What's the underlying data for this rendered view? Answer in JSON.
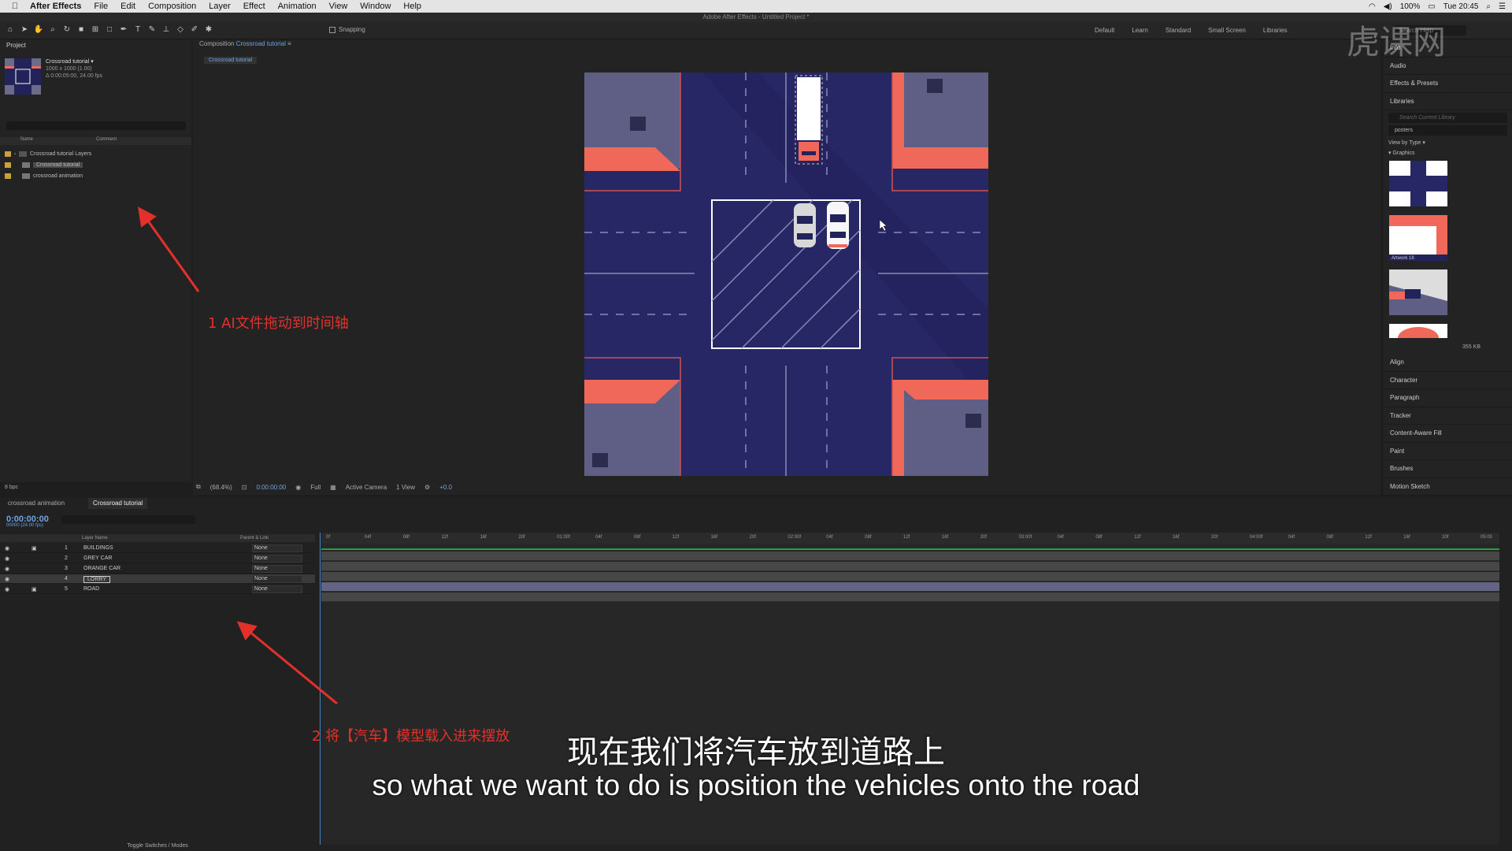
{
  "menubar": {
    "app_name": "After Effects",
    "items": [
      "File",
      "Edit",
      "Composition",
      "Layer",
      "Effect",
      "Animation",
      "View",
      "Window",
      "Help"
    ],
    "battery": "100%",
    "clock": "Tue 20:45"
  },
  "window_title": "Adobe After Effects - Untitled Project *",
  "toolbar": {
    "snapping_label": "Snapping",
    "workspaces": [
      "Default",
      "Learn",
      "Standard",
      "Small Screen",
      "Libraries"
    ],
    "search_placeholder": "Search Help"
  },
  "project_panel": {
    "tab": "Project",
    "comp_name": "Crossroad tutorial ▾",
    "comp_size": "1000 x 1000 (1.00)",
    "comp_duration": "Δ 0:00:05:00, 24.00 fps",
    "col_name": "Name",
    "col_comment": "Comment",
    "items": [
      {
        "label": "Crossroad tutorial Layers"
      },
      {
        "label": "Crossroad tutorial"
      },
      {
        "label": "crossroad animation"
      }
    ],
    "bpc": "8 bpc"
  },
  "comp_panel": {
    "tab_prefix": "Composition",
    "tab_name": "Crossroad tutorial",
    "subtab": "Crossroad tutorial",
    "zoom": "(68.4%)",
    "timecode": "0:00:00:00",
    "resolution": "Full",
    "camera": "Active Camera",
    "views": "1 View",
    "exposure": "+0.0"
  },
  "right_panel": {
    "info": "Info",
    "audio": "Audio",
    "effects": "Effects & Presets",
    "libraries": "Libraries",
    "lib_search_placeholder": "Search Current Library",
    "lib_selected": "posters",
    "view_by": "View by Type ▾",
    "graphics": "▾ Graphics",
    "artwork_label": "Artwork 18",
    "size": "355 KB",
    "links": [
      "Align",
      "Character",
      "Paragraph",
      "Tracker",
      "Content-Aware Fill",
      "Paint",
      "Brushes",
      "Motion Sketch"
    ]
  },
  "timeline": {
    "tabs": [
      "crossroad animation",
      "Crossroad tutorial"
    ],
    "timecode": "0:00:00:00",
    "fps_note": "00000 (24.00 fps)",
    "col_layer": "Layer Name",
    "col_parent": "Parent & Link",
    "layers": [
      {
        "num": "1",
        "name": "BUILDINGS",
        "parent": "None"
      },
      {
        "num": "2",
        "name": "GREY CAR",
        "parent": "None"
      },
      {
        "num": "3",
        "name": "ORANGE CAR",
        "parent": "None"
      },
      {
        "num": "4",
        "name": "LORRY",
        "parent": "None"
      },
      {
        "num": "5",
        "name": "ROAD",
        "parent": "None"
      }
    ],
    "ruler": [
      "0f",
      "04f",
      "08f",
      "12f",
      "16f",
      "20f",
      "01:00f",
      "04f",
      "08f",
      "12f",
      "16f",
      "20f",
      "02:00f",
      "04f",
      "08f",
      "12f",
      "16f",
      "20f",
      "03:00f",
      "04f",
      "08f",
      "12f",
      "16f",
      "20f",
      "04:00f",
      "04f",
      "08f",
      "12f",
      "16f",
      "20f",
      "05:00"
    ],
    "footer": "Toggle Switches / Modes"
  },
  "annotations": {
    "a1": "1 AI文件拖动到时间轴",
    "a2": "2 将【汽车】模型载入进来摆放"
  },
  "subtitles": {
    "cn": "现在我们将汽车放到道路上",
    "en": "so what we want to do is position the vehicles onto the road"
  },
  "watermark": "虎课网",
  "colors": {
    "accent": "#6fa3e0",
    "annotation": "#e4302b",
    "road": "#282766",
    "building_roof": "#f0685a"
  }
}
